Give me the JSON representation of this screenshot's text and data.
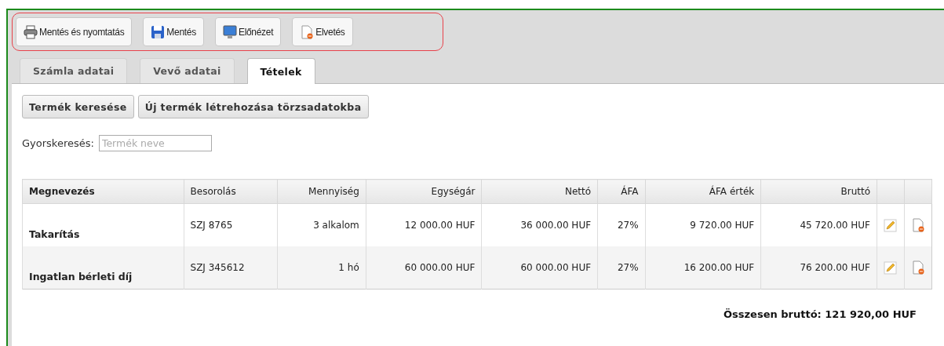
{
  "toolbar": [
    {
      "label": "Mentés és nyomtatás",
      "kind": "print"
    },
    {
      "label": "Mentés",
      "kind": "save"
    },
    {
      "label": "Előnézet",
      "kind": "preview"
    },
    {
      "label": "Elvetés",
      "kind": "discard"
    }
  ],
  "tabs": [
    {
      "label": "Számla adatai",
      "selected": false
    },
    {
      "label": "Vevő adatai",
      "selected": false
    },
    {
      "label": "Tételek",
      "selected": true
    }
  ],
  "actions": [
    "Termék keresése",
    "Új termék létrehozása törzsadatokba"
  ],
  "quick_search": {
    "label": "Gyorskeresés:",
    "placeholder": "Termék neve"
  },
  "table": {
    "columns": [
      "Megnevezés",
      "Besorolás",
      "Mennyiség",
      "Egységár",
      "Nettó",
      "ÁFA",
      "ÁFA érték",
      "Bruttó"
    ],
    "rows": [
      [
        "Takarítás",
        "SZJ 8765",
        "3 alkalom",
        "12 000.00 HUF",
        "36 000.00 HUF",
        "27%",
        "9 720.00 HUF",
        "45 720.00 HUF"
      ],
      [
        "Ingatlan bérleti díj",
        "SZJ 345612",
        "1 hó",
        "60 000.00 HUF",
        "60 000.00 HUF",
        "27%",
        "16 200.00 HUF",
        "76 200.00 HUF"
      ]
    ]
  },
  "total": "Összesen bruttó: 121 920,00 HUF"
}
